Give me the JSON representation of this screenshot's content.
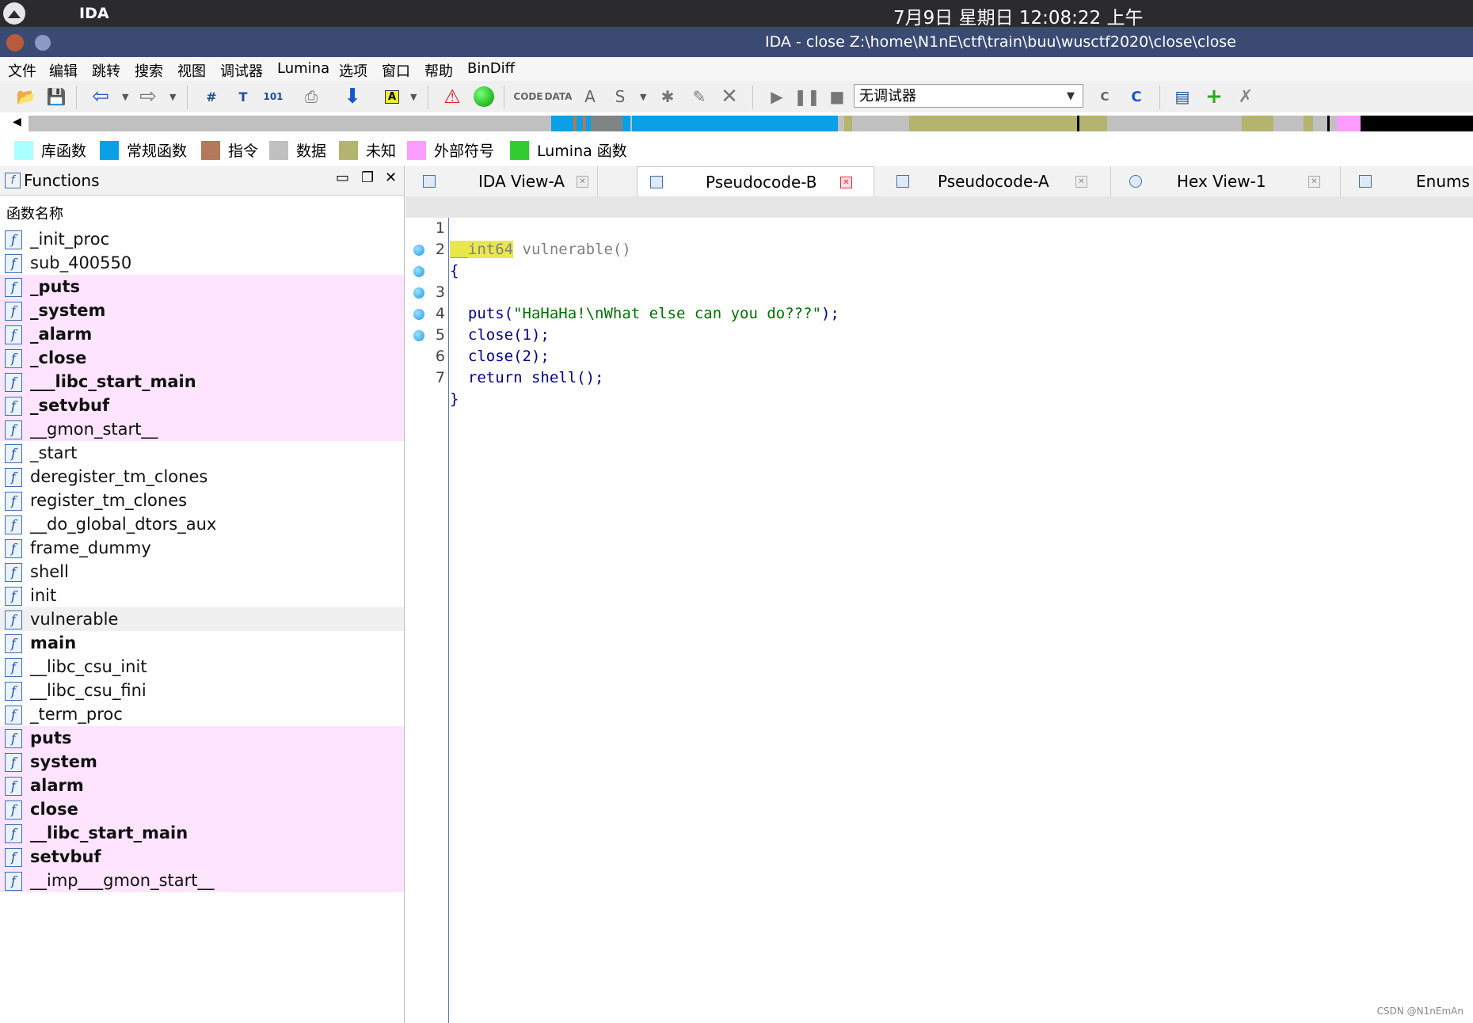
{
  "system_bar": {
    "app_name": "IDA",
    "clock": "7月9日 星期日 12:08:22 上午"
  },
  "window": {
    "title": "IDA - close Z:\\home\\N1nE\\ctf\\train\\buu\\wusctf2020\\close\\close"
  },
  "menu": [
    "文件",
    "编辑",
    "跳转",
    "搜索",
    "视图",
    "调试器",
    "Lumina",
    "选项",
    "窗口",
    "帮助",
    "BinDiff"
  ],
  "toolbar": {
    "debugger_select": "无调试器"
  },
  "legend": [
    {
      "label": "库函数",
      "color": "#aaffff"
    },
    {
      "label": "常规函数",
      "color": "#0aa0e6"
    },
    {
      "label": "指令",
      "color": "#b4785a"
    },
    {
      "label": "数据",
      "color": "#c0c0c0"
    },
    {
      "label": "未知",
      "color": "#b4b46e"
    },
    {
      "label": "外部符号",
      "color": "#ff9cff"
    },
    {
      "label": "Lumina 函数",
      "color": "#32cd32"
    }
  ],
  "functions_panel": {
    "title": "Functions",
    "column_header": "函数名称",
    "items": [
      {
        "name": "_init_proc",
        "style": "normal"
      },
      {
        "name": "sub_400550",
        "style": "normal"
      },
      {
        "name": "_puts",
        "style": "ext-bold"
      },
      {
        "name": "_system",
        "style": "ext-bold"
      },
      {
        "name": "_alarm",
        "style": "ext-bold"
      },
      {
        "name": "_close",
        "style": "ext-bold"
      },
      {
        "name": "___libc_start_main",
        "style": "ext-bold"
      },
      {
        "name": "_setvbuf",
        "style": "ext-bold"
      },
      {
        "name": "__gmon_start__",
        "style": "ext"
      },
      {
        "name": "_start",
        "style": "normal"
      },
      {
        "name": "deregister_tm_clones",
        "style": "normal"
      },
      {
        "name": "register_tm_clones",
        "style": "normal"
      },
      {
        "name": "__do_global_dtors_aux",
        "style": "normal"
      },
      {
        "name": "frame_dummy",
        "style": "normal"
      },
      {
        "name": "shell",
        "style": "normal"
      },
      {
        "name": "init",
        "style": "normal"
      },
      {
        "name": "vulnerable",
        "style": "selected"
      },
      {
        "name": "main",
        "style": "bold"
      },
      {
        "name": "__libc_csu_init",
        "style": "normal"
      },
      {
        "name": "__libc_csu_fini",
        "style": "normal"
      },
      {
        "name": "_term_proc",
        "style": "normal"
      },
      {
        "name": "puts",
        "style": "ext-bold"
      },
      {
        "name": "system",
        "style": "ext-bold"
      },
      {
        "name": "alarm",
        "style": "ext-bold"
      },
      {
        "name": "close",
        "style": "ext-bold"
      },
      {
        "name": "__libc_start_main",
        "style": "ext-bold"
      },
      {
        "name": "setvbuf",
        "style": "ext-bold"
      },
      {
        "name": "__imp___gmon_start__",
        "style": "ext"
      }
    ]
  },
  "tabs": [
    {
      "label": "IDA View-A",
      "active": false
    },
    {
      "label": "Pseudocode-B",
      "active": true
    },
    {
      "label": "Pseudocode-A",
      "active": false
    },
    {
      "label": "Hex View-1",
      "active": false
    },
    {
      "label": "Enums",
      "active": false
    }
  ],
  "code": {
    "line_numbers": [
      "1",
      "2",
      "3",
      "4",
      "5",
      "6",
      "7"
    ],
    "line1_type": "__int64",
    "line1_sig": " vulnerable()",
    "line2": "{",
    "line3_fn": "  puts(",
    "line3_str": "\"HaHaHa!\\nWhat else can you do???\"",
    "line3_end": ");",
    "line4": "  close(1);",
    "line5": "  close(2);",
    "line6": "  return shell();",
    "line7": "}"
  },
  "watermark": "CSDN @N1nEmAn"
}
